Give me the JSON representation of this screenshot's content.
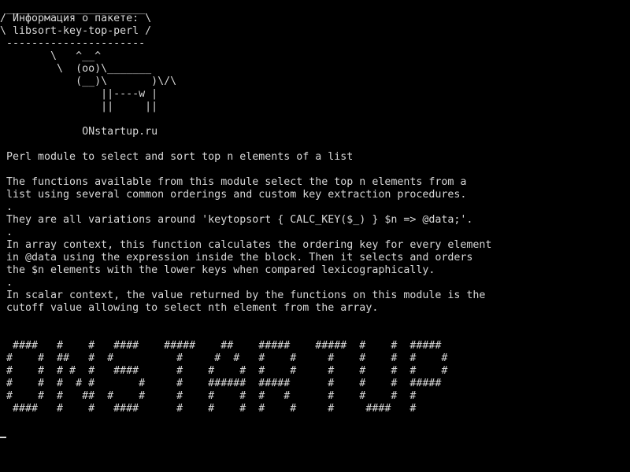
{
  "terminal": {
    "cowsay_bubble": [
      " ______________________",
      "/ Информация о пакете: \\",
      "\\ libsort-key-top-perl /",
      " ----------------------"
    ],
    "cow": [
      "        \\   ^__^",
      "         \\  (oo)\\_______",
      "            (__)\\       )\\/\\",
      "                ||----w |",
      "                ||     ||"
    ],
    "site": "             ONstartup.ru",
    "description": [
      " Perl module to select and sort top n elements of a list",
      "",
      " The functions available from this module select the top n elements from a",
      " list using several common orderings and custom key extraction procedures.",
      " .",
      " They are all variations around 'keytopsort { CALC_KEY($_) } $n => @data;'.",
      " .",
      " In array context, this function calculates the ordering key for every element",
      " in @data using the expression inside the block. Then it selects and orders",
      " the $n elements with the lower keys when compared lexicographically.",
      " .",
      " In scalar context, the value returned by the functions on this module is the",
      " cutoff value allowing to select nth element from the array."
    ],
    "banner": [
      "  ####   #    #   ####    #####    ##    #####    #####  #    #  #####",
      " #    #  ##   #  #          #     #  #   #    #     #    #    #  #    #",
      " #    #  # #  #   ####      #    #    #  #    #     #    #    #  #    #",
      " #    #  #  # #       #     #    ######  #####      #    #    #  #####",
      " #    #  #   ##  #    #     #    #    #  #   #      #    #    #  #",
      "  ####   #    #   ####      #    #    #  #    #     #     ####   #"
    ]
  }
}
